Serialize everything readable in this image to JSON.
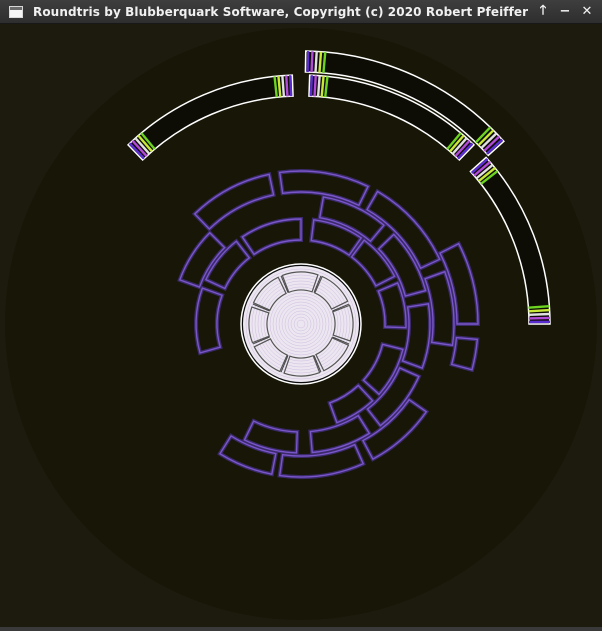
{
  "window": {
    "title": "Roundtris by Blubberquark Software, Copyright (c) 2020 Robert Pfeiffer",
    "buttons": {
      "maximize": "🡑",
      "minimize": "−",
      "close": "✕"
    }
  },
  "game": {
    "colors": {
      "background": "#1c1b0d",
      "playfield": "#181707",
      "core": "#ece6f0",
      "core_rings": "#b49ad2",
      "settled_block": "#7a56c8",
      "falling_outline": "#ffffff",
      "end_cap": [
        "#5a2bd0",
        "#b14ad8",
        "#e0e0e0",
        "#c8e838",
        "#6cd420"
      ]
    },
    "core": {
      "inner_ring_segments": 8,
      "ring1_segments": 8
    },
    "settled_segments": [
      {
        "ring": 2,
        "from_deg": 277,
        "to_deg": 305
      },
      {
        "ring": 2,
        "from_deg": 307,
        "to_deg": 333
      },
      {
        "ring": 2,
        "from_deg": 337,
        "to_deg": 362
      },
      {
        "ring": 2,
        "from_deg": 14,
        "to_deg": 42
      },
      {
        "ring": 2,
        "from_deg": 47,
        "to_deg": 70
      },
      {
        "ring": 2,
        "from_deg": 164,
        "to_deg": 200
      },
      {
        "ring": 2,
        "from_deg": 205,
        "to_deg": 232
      },
      {
        "ring": 2,
        "from_deg": 236,
        "to_deg": 270
      },
      {
        "ring": 3,
        "from_deg": 280,
        "to_deg": 310
      },
      {
        "ring": 3,
        "from_deg": 316,
        "to_deg": 345
      },
      {
        "ring": 3,
        "from_deg": 351,
        "to_deg": 380
      },
      {
        "ring": 3,
        "from_deg": 24,
        "to_deg": 52
      },
      {
        "ring": 3,
        "from_deg": 58,
        "to_deg": 85
      },
      {
        "ring": 3,
        "from_deg": 92,
        "to_deg": 116
      },
      {
        "ring": 3,
        "from_deg": 200,
        "to_deg": 225
      },
      {
        "ring": 4,
        "from_deg": 300,
        "to_deg": 335
      },
      {
        "ring": 4,
        "from_deg": 340,
        "to_deg": 368
      },
      {
        "ring": 4,
        "from_deg": 35,
        "to_deg": 62
      },
      {
        "ring": 4,
        "from_deg": 66,
        "to_deg": 98
      },
      {
        "ring": 4,
        "from_deg": 101,
        "to_deg": 122
      },
      {
        "ring": 4,
        "from_deg": 226,
        "to_deg": 258
      },
      {
        "ring": 4,
        "from_deg": 262,
        "to_deg": 296
      },
      {
        "ring": 5,
        "from_deg": 333,
        "to_deg": 360
      },
      {
        "ring": 5,
        "from_deg": 365,
        "to_deg": 375
      }
    ],
    "falling_pieces": [
      {
        "ring": 8,
        "from_deg": 226,
        "to_deg": 268
      },
      {
        "ring": 9,
        "from_deg": 271,
        "to_deg": 318
      },
      {
        "ring": 8,
        "from_deg": 272,
        "to_deg": 314
      },
      {
        "ring": 8,
        "from_deg": 318,
        "to_deg": 360
      }
    ]
  }
}
